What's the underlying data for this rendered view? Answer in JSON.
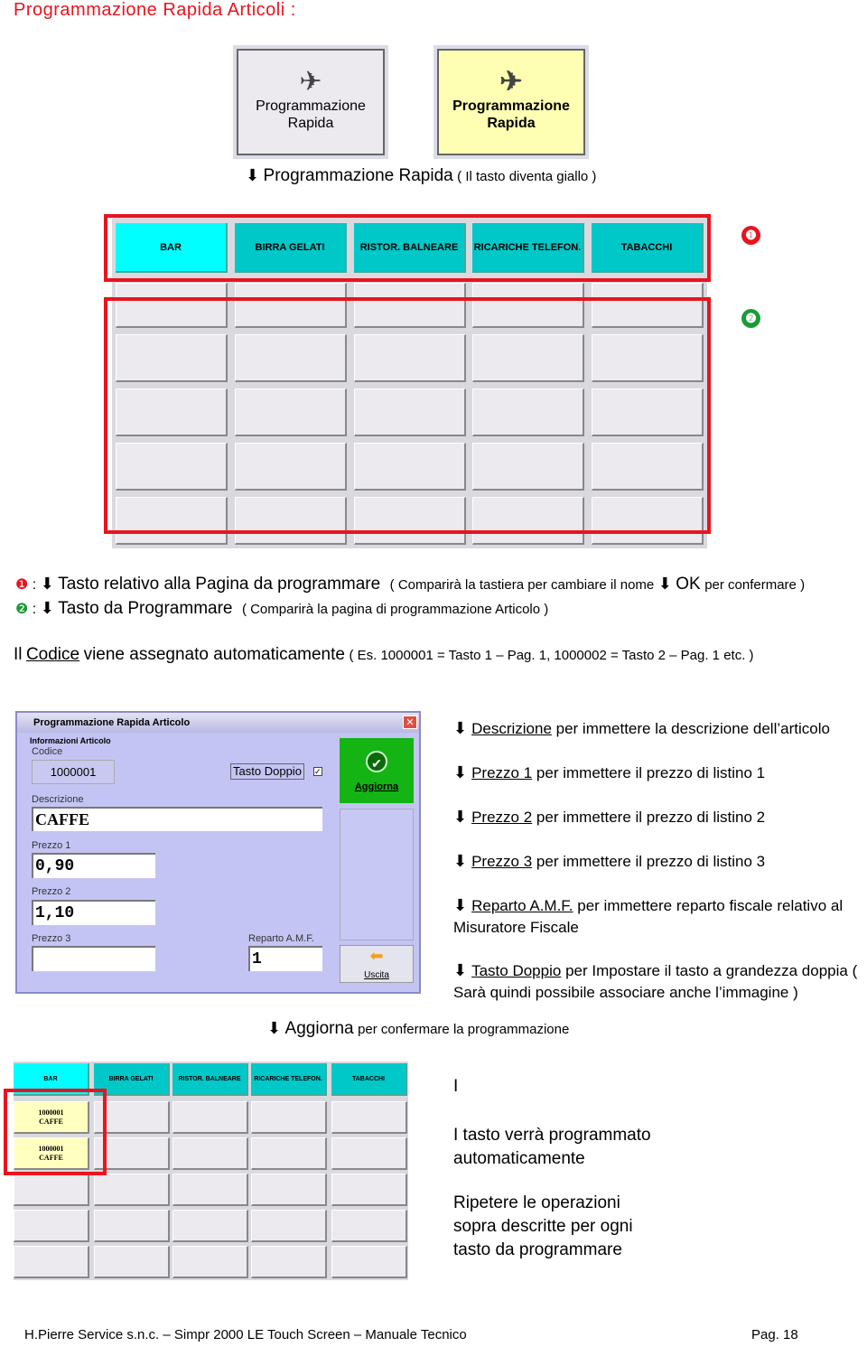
{
  "title": "Programmazione Rapida Articoli :",
  "buttons": {
    "normal": "Programmazione Rapida",
    "yellow": "Programmazione Rapida",
    "caption_main": "Programmazione Rapida",
    "caption_note": "( Il tasto diventa giallo )"
  },
  "tabs": [
    "BAR",
    "BIRRA GELATI",
    "RISTOR. BALNEARE",
    "RICARICHE TELEFON.",
    "TABACCHI"
  ],
  "markers": {
    "one": "❶",
    "two": "❷"
  },
  "notes": {
    "n1_main": "Tasto relativo alla Pagina da programmare",
    "n1_note": "( Comparirà la tastiera per cambiare il nome",
    "n1_ok": "OK",
    "n1_end": "per confermare )",
    "n2_main": "Tasto da Programmare",
    "n2_note": "( Comparirà la pagina di programmazione Articolo )",
    "codice_pre": "Il",
    "codice_link": "Codice",
    "codice_post": "viene assegnato automaticamente",
    "codice_note": "( Es. 1000001 = Tasto 1 – Pag. 1, 1000002 = Tasto 2 – Pag. 1 etc. )"
  },
  "dialog": {
    "title": "Programmazione Rapida Articolo",
    "group": "Informazioni Articolo",
    "codice_label": "Codice",
    "codice": "1000001",
    "tasto_doppio": "Tasto Doppio",
    "tasto_doppio_checked": true,
    "descrizione_label": "Descrizione",
    "descrizione": "CAFFE",
    "prezzo1_label": "Prezzo 1",
    "prezzo1": "0,90",
    "prezzo2_label": "Prezzo 2",
    "prezzo2": "1,10",
    "prezzo3_label": "Prezzo 3",
    "prezzo3": "",
    "reparto_label": "Reparto A.M.F.",
    "reparto": "1",
    "aggiorna": "Aggiorna",
    "uscita": "Uscita"
  },
  "desc": [
    {
      "link": "Descrizione",
      "text": "per immettere la descrizione dell’articolo"
    },
    {
      "link": "Prezzo 1",
      "text": "per immettere il prezzo di listino 1"
    },
    {
      "link": "Prezzo 2",
      "text": "per immettere il prezzo di listino 2"
    },
    {
      "link": "Prezzo 3",
      "text": "per immettere il prezzo di listino 3"
    },
    {
      "link": "Reparto A.M.F.",
      "text": "per immettere reparto fiscale relativo al Misuratore Fiscale"
    },
    {
      "link": "Tasto Doppio",
      "text": "per Impostare il tasto a grandezza doppia ( Sarà quindi possibile associare anche l’immagine )"
    }
  ],
  "aggiorna_main": "Aggiorna",
  "aggiorna_note": "per confermare la programmazione",
  "result": {
    "cell_code": "1000001",
    "cell_name": "CAFFE",
    "i": "I",
    "p1": "I tasto verrà programmato automaticamente",
    "p2": "Ripetere le operazioni sopra descritte per ogni tasto da programmare"
  },
  "footer": {
    "company": "H.Pierre Service s.n.c.",
    "doc": "– Simpr 2000 LE Touch Screen – Manuale Tecnico",
    "page": "Pag. 18"
  },
  "colors": {
    "red": "#e8141e",
    "cyan": "#00ffff",
    "teal": "#00c8c8",
    "yellow": "#ffffc0",
    "green": "#14b414",
    "marker1": "#e8141e",
    "marker2": "#1a9a3a"
  }
}
